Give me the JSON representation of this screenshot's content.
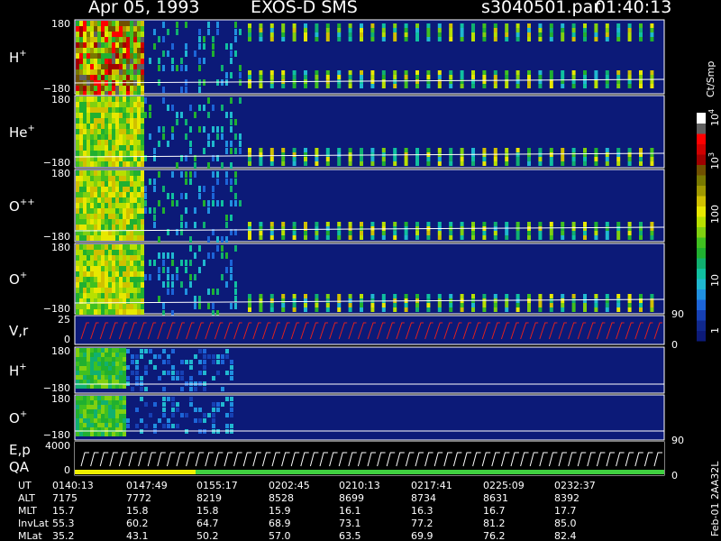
{
  "header": {
    "date": "Apr 05, 1993",
    "instrument": "EXOS-D SMS",
    "file": "s3040501.par",
    "time": "01:40:13"
  },
  "colors": {
    "background": "#000000",
    "panel_fill": "#0c1a78",
    "velocity_trace": "#e02020",
    "qa_bar_yellow": "#f0f000",
    "qa_bar_green": "#40d040"
  },
  "chart_data": {
    "type": "heatmap",
    "panels": [
      {
        "label": "H",
        "superscript": "+",
        "y_top": "180",
        "y_bottom": "−180"
      },
      {
        "label": "He",
        "superscript": "+",
        "y_top": "180",
        "y_bottom": "−180"
      },
      {
        "label": "O",
        "superscript": "++",
        "y_top": "180",
        "y_bottom": "−180"
      },
      {
        "label": "O",
        "superscript": "+",
        "y_top": "180",
        "y_bottom": "−180",
        "right_tick": "90"
      },
      {
        "label": "V,r",
        "superscript": "",
        "y_top": "25",
        "y_bottom": "0",
        "right_tick": "0"
      },
      {
        "label": "H",
        "superscript": "+",
        "y_top": "180",
        "y_bottom": "−180"
      },
      {
        "label": "O",
        "superscript": "+",
        "y_top": "180",
        "y_bottom": "−180",
        "right_tick": "90"
      },
      {
        "label": "E,p",
        "label2": "QA",
        "superscript": "",
        "y_top": "4000",
        "y_bottom": "0",
        "right_tick": "0"
      }
    ],
    "colorbar": {
      "title": "Ct/Smp",
      "ticks": [
        {
          "label": "1",
          "exp": ""
        },
        {
          "label": "10",
          "exp": ""
        },
        {
          "label": "100",
          "exp": ""
        },
        {
          "label": "10",
          "exp": "3"
        },
        {
          "label": "10",
          "exp": "4"
        }
      ],
      "colors": [
        "#0c1a78",
        "#10288c",
        "#1640b4",
        "#1c64d8",
        "#2090e0",
        "#20b8d0",
        "#10c0a0",
        "#10b070",
        "#20b030",
        "#40c020",
        "#80d010",
        "#b8e000",
        "#e8e800",
        "#d0c000",
        "#a09800",
        "#787800",
        "#705000",
        "#a00000",
        "#d00000",
        "#ff0000",
        "#606060",
        "#ffffff"
      ]
    },
    "x_axis": {
      "rows": [
        {
          "name": "UT",
          "values": [
            "0140:13",
            "0147:49",
            "0155:17",
            "0202:45",
            "0210:13",
            "0217:41",
            "0225:09",
            "0232:37"
          ]
        },
        {
          "name": "ALT",
          "values": [
            "7175",
            "7772",
            "8219",
            "8528",
            "8699",
            "8734",
            "8631",
            "8392"
          ]
        },
        {
          "name": "MLT",
          "values": [
            "15.7",
            "15.8",
            "15.8",
            "15.9",
            "16.1",
            "16.3",
            "16.7",
            "17.7"
          ]
        },
        {
          "name": "InvLat",
          "values": [
            "55.3",
            "60.2",
            "64.7",
            "68.9",
            "73.1",
            "77.2",
            "81.2",
            "85.0"
          ]
        },
        {
          "name": "MLat",
          "values": [
            "35.2",
            "43.1",
            "50.2",
            "57.0",
            "63.5",
            "69.9",
            "76.2",
            "82.4"
          ]
        }
      ]
    },
    "footer": "Feb-01 2AA32L"
  }
}
